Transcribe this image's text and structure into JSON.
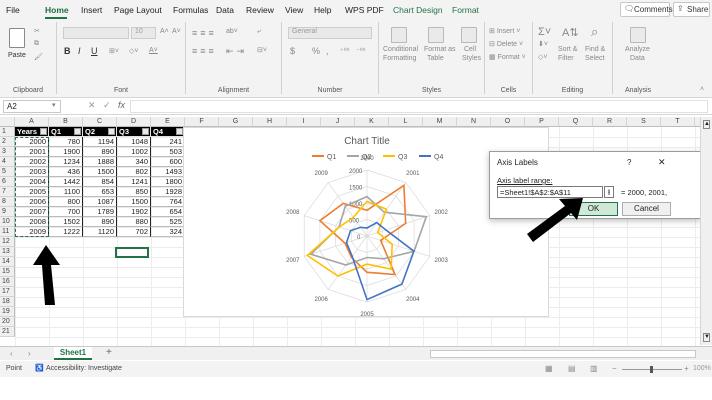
{
  "menu": {
    "items": [
      "File",
      "Home",
      "Insert",
      "Page Layout",
      "Formulas",
      "Data",
      "Review",
      "View",
      "Help",
      "WPS PDF",
      "Chart Design",
      "Format"
    ],
    "comments": "Comments",
    "share": "Share"
  },
  "ribbon": {
    "clipboard": {
      "label": "Clipboard",
      "paste": "Paste"
    },
    "font": {
      "label": "Font",
      "name": "",
      "size": "10",
      "bold": "B",
      "italic": "I",
      "underline": "U"
    },
    "alignment": {
      "label": "Alignment"
    },
    "number": {
      "label": "Number",
      "format": "General",
      "currency": "$",
      "percent": "%",
      "comma": ","
    },
    "styles": {
      "label": "Styles",
      "conditional": "Conditional",
      "formatting": "Formatting",
      "format_as": "Format as",
      "table": "Table",
      "cell": "Cell",
      "cell_styles": "Styles"
    },
    "cells": {
      "label": "Cells",
      "insert": "Insert",
      "delete": "Delete",
      "format": "Format"
    },
    "editing": {
      "label": "Editing",
      "sort": "Sort &",
      "filter": "Filter",
      "find": "Find &",
      "select": "Select"
    },
    "analysis": {
      "label": "Analysis",
      "analyze": "Analyze",
      "data": "Data"
    }
  },
  "formula_bar": {
    "name_box": "A2",
    "fx": "fx",
    "value": ""
  },
  "sheet": {
    "columns": [
      "A",
      "B",
      "C",
      "D",
      "E",
      "F",
      "G",
      "H",
      "I",
      "J",
      "K",
      "L",
      "M",
      "N",
      "O",
      "P",
      "Q",
      "R",
      "S",
      "T",
      "U"
    ],
    "rows": [
      "1",
      "2",
      "3",
      "4",
      "5",
      "6",
      "7",
      "8",
      "9",
      "10",
      "11",
      "12",
      "13",
      "14",
      "15",
      "16",
      "17",
      "18",
      "19",
      "20",
      "21"
    ],
    "headers": [
      "Years",
      "Q1",
      "Q2",
      "Q3",
      "Q4"
    ],
    "data": [
      [
        "2000",
        "780",
        "1194",
        "1048",
        "241"
      ],
      [
        "2001",
        "1900",
        "890",
        "1002",
        "503"
      ],
      [
        "2002",
        "1234",
        "1888",
        "340",
        "600"
      ],
      [
        "2003",
        "436",
        "1500",
        "802",
        "1493"
      ],
      [
        "2004",
        "1442",
        "854",
        "1241",
        "1800"
      ],
      [
        "2005",
        "1100",
        "653",
        "850",
        "1928"
      ],
      [
        "2006",
        "800",
        "1087",
        "1500",
        "764"
      ],
      [
        "2007",
        "700",
        "1789",
        "1902",
        "654"
      ],
      [
        "2008",
        "1502",
        "890",
        "880",
        "525"
      ],
      [
        "2009",
        "1222",
        "1120",
        "702",
        "324"
      ]
    ]
  },
  "chart_data": {
    "type": "radar",
    "title": "Chart Title",
    "categories": [
      "2000",
      "2001",
      "2002",
      "2003",
      "2004",
      "2005",
      "2006",
      "2007",
      "2008",
      "2009"
    ],
    "series": [
      {
        "name": "Q1",
        "color": "#ed7d31",
        "values": [
          780,
          1900,
          1234,
          436,
          1442,
          1100,
          800,
          700,
          1502,
          1222
        ]
      },
      {
        "name": "Q2",
        "color": "#a5a5a5",
        "values": [
          1194,
          890,
          1888,
          1500,
          854,
          653,
          1087,
          1789,
          890,
          1120
        ]
      },
      {
        "name": "Q3",
        "color": "#ffc000",
        "values": [
          1048,
          1002,
          340,
          802,
          1241,
          850,
          1500,
          1902,
          880,
          702
        ]
      },
      {
        "name": "Q4",
        "color": "#4472c4",
        "values": [
          241,
          503,
          600,
          1493,
          1800,
          1928,
          764,
          654,
          525,
          324
        ]
      }
    ],
    "ticks": [
      "0",
      "500",
      "1000",
      "1500",
      "2000"
    ],
    "rmax": 2000,
    "legend": "top"
  },
  "dialog": {
    "title": "Axis Labels",
    "help": "?",
    "close": "✕",
    "field_label": "Axis label range:",
    "value": "=Sheet1!$A$2:$A$11",
    "preview": "= 2000, 2001,",
    "ok": "OK",
    "cancel": "Cancel"
  },
  "tabs": {
    "sheet": "Sheet1",
    "add": "+"
  },
  "status": {
    "mode": "Point",
    "accessibility": "Accessibility: Investigate",
    "zoom": "100%"
  },
  "colors": {
    "excel_green": "#217346",
    "arrow": "#000000"
  }
}
